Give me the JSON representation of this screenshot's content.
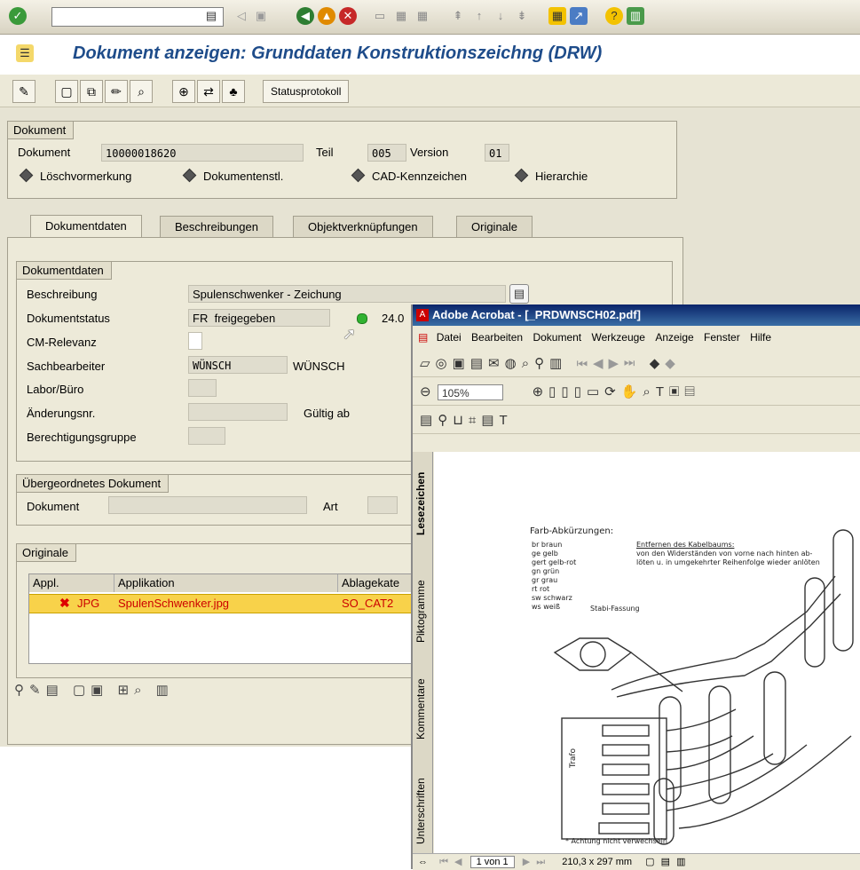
{
  "window": {
    "title": "Dokument anzeigen: Grunddaten  Konstruktionszeichng (DRW)"
  },
  "app_toolbar": {
    "status_button": "Statusprotokoll"
  },
  "doc_header": {
    "group_title": "Dokument",
    "doc_label": "Dokument",
    "doc_value": "10000018620",
    "part_label": "Teil",
    "part_value": "005",
    "version_label": "Version",
    "version_value": "01",
    "links": [
      "Löschvormerkung",
      "Dokumentenstl.",
      "CAD-Kennzeichen",
      "Hierarchie"
    ]
  },
  "tabs": [
    "Dokumentdaten",
    "Beschreibungen",
    "Objektverknüpfungen",
    "Originale"
  ],
  "doc_data": {
    "group_title": "Dokumentdaten",
    "desc_label": "Beschreibung",
    "desc_value": "Spulenschwenker - Zeichung",
    "status_label": "Dokumentstatus",
    "status_code": "FR",
    "status_text": "freigegeben",
    "status_date": "24.0",
    "cm_label": "CM-Relevanz",
    "clerk_label": "Sachbearbeiter",
    "clerk_value": "WÜNSCH",
    "clerk_text": "WÜNSCH",
    "lab_label": "Labor/Büro",
    "change_label": "Änderungsnr.",
    "valid_label": "Gültig ab",
    "auth_label": "Berechtigungsgruppe"
  },
  "parent_doc": {
    "group_title": "Übergeordnetes Dokument",
    "doc_label": "Dokument",
    "art_label": "Art"
  },
  "originals": {
    "group_title": "Originale",
    "columns": [
      "Appl.",
      "Applikation",
      "Ablagekate"
    ],
    "row": {
      "appl": "JPG",
      "application": "SpulenSchwenker.jpg",
      "storage": "SO_CAT2"
    }
  },
  "acrobat": {
    "title": "Adobe Acrobat - [_PRDWNSCH02.pdf]",
    "menu": [
      "Datei",
      "Bearbeiten",
      "Dokument",
      "Werkzeuge",
      "Anzeige",
      "Fenster",
      "Hilfe"
    ],
    "zoom": "105%",
    "side_tabs": [
      "Lesezeichen",
      "Piktogramme",
      "Kommentare",
      "Unterschriften"
    ],
    "page_label": "1 von 1",
    "page_size": "210,3 x 297 mm"
  },
  "drawing": {
    "heading": "Farb-Abkürzungen:",
    "legend": [
      "br   braun",
      "ge   gelb",
      "gert gelb-rot",
      "gn   grün",
      "gr   grau",
      "rt    rot",
      "sw  schwarz",
      "ws  weiß"
    ],
    "note_title": "Entfernen des Kabelbaums:",
    "note_line1": "von den Widerständen von vorne nach hinten ab-",
    "note_line2": "löten u. in umgekehrter Reihenfolge wieder anlöten",
    "stab": "Stabi-Fassung",
    "trafo": "Trafo",
    "warning": "* Achtung nicht verwechseln"
  },
  "colors": {
    "title_blue": "#1e4c8a",
    "selection": "#f8d24a",
    "acrobat_title": "#0a246a"
  }
}
